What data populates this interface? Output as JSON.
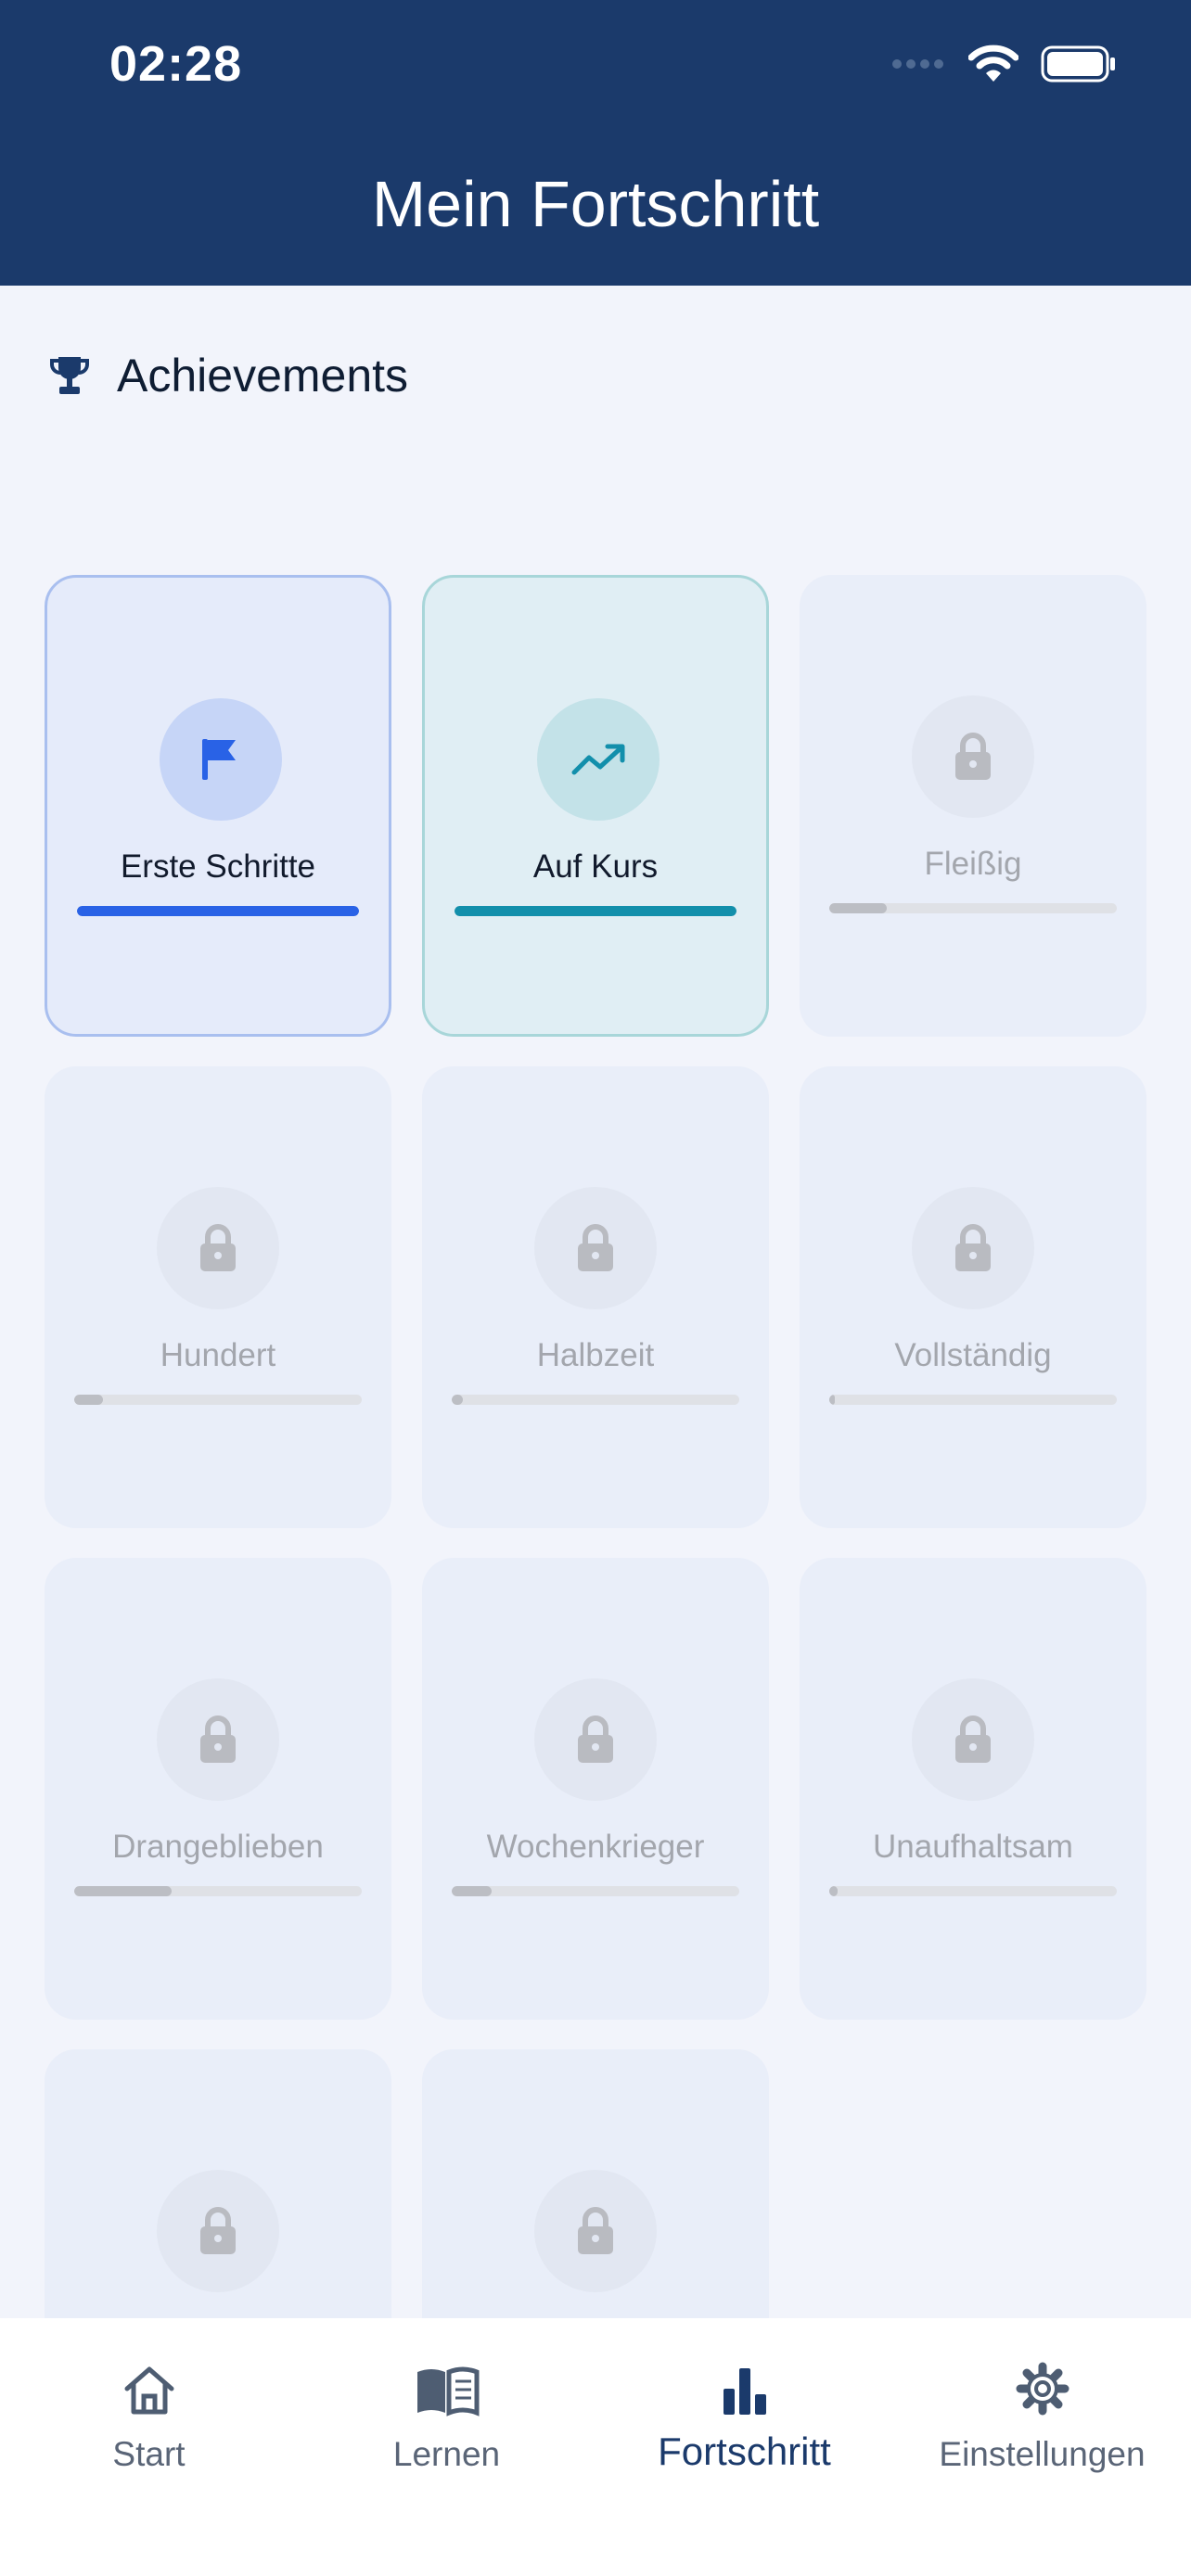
{
  "status": {
    "time": "02:28"
  },
  "header": {
    "title": "Mein Fortschritt"
  },
  "section": {
    "title": "Achievements",
    "icon": "trophy-icon"
  },
  "achievements": [
    {
      "label": "Erste Schritte",
      "state": "unlocked",
      "icon": "flag-icon",
      "progress": 1.0,
      "color": "#2962e6"
    },
    {
      "label": "Auf Kurs",
      "state": "unlocked",
      "icon": "trend-up-icon",
      "progress": 1.0,
      "color": "#128fab"
    },
    {
      "label": "Fleißig",
      "state": "locked",
      "icon": "lock-icon",
      "progress": 0.2
    },
    {
      "label": "Hundert",
      "state": "locked",
      "icon": "lock-icon",
      "progress": 0.1
    },
    {
      "label": "Halbzeit",
      "state": "locked",
      "icon": "lock-icon",
      "progress": 0.04
    },
    {
      "label": "Vollständig",
      "state": "locked",
      "icon": "lock-icon",
      "progress": 0.02
    },
    {
      "label": "Drangeblieben",
      "state": "locked",
      "icon": "lock-icon",
      "progress": 0.34
    },
    {
      "label": "Wochenkrieger",
      "state": "locked",
      "icon": "lock-icon",
      "progress": 0.14
    },
    {
      "label": "Unaufhaltsam",
      "state": "locked",
      "icon": "lock-icon",
      "progress": 0.03
    },
    {
      "label": "",
      "state": "locked",
      "icon": "lock-icon",
      "progress": 0
    },
    {
      "label": "",
      "state": "locked",
      "icon": "lock-icon",
      "progress": 0
    }
  ],
  "nav": {
    "items": [
      {
        "label": "Start",
        "icon": "home-icon",
        "active": false
      },
      {
        "label": "Lernen",
        "icon": "book-icon",
        "active": false
      },
      {
        "label": "Fortschritt",
        "icon": "bar-chart-icon",
        "active": true
      },
      {
        "label": "Einstellungen",
        "icon": "gear-icon",
        "active": false
      }
    ]
  },
  "colors": {
    "header": "#1b3a6b",
    "background": "#f2f4fb",
    "unlocked_blue": "#2962e6",
    "unlocked_teal": "#128fab",
    "locked": "#bcbec4"
  }
}
